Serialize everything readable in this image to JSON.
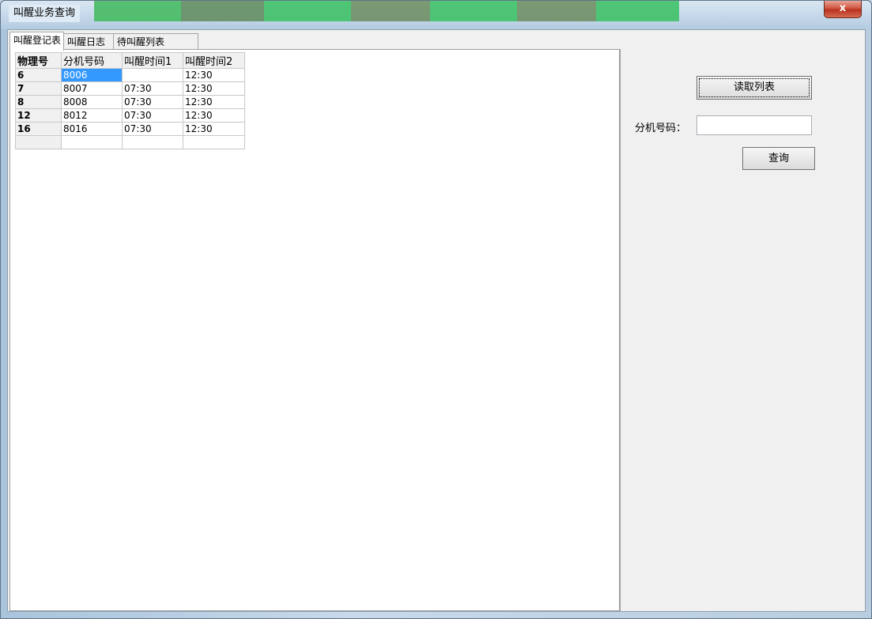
{
  "window": {
    "title": "叫醒业务查询",
    "close_label": "x"
  },
  "tabs": [
    {
      "label": "叫醒登记表"
    },
    {
      "label": "叫醒日志"
    },
    {
      "label": "待叫醒列表"
    }
  ],
  "grid": {
    "headers": [
      "物理号",
      "分机号码",
      "叫醒时间1",
      "叫醒时间2"
    ],
    "rows": [
      {
        "id": "6",
        "ext": "8006",
        "t1": "",
        "t2": "12:30"
      },
      {
        "id": "7",
        "ext": "8007",
        "t1": "07:30",
        "t2": "12:30"
      },
      {
        "id": "8",
        "ext": "8008",
        "t1": "07:30",
        "t2": "12:30"
      },
      {
        "id": "12",
        "ext": "8012",
        "t1": "07:30",
        "t2": "12:30"
      },
      {
        "id": "16",
        "ext": "8016",
        "t1": "07:30",
        "t2": "12:30"
      }
    ],
    "selected_cell": "8006"
  },
  "panel": {
    "read_list_label": "读取列表",
    "ext_label": "分机号码：",
    "ext_value": "",
    "query_label": "查询"
  },
  "colors": {
    "selection": "#3399ff",
    "close_button": "#c9462f"
  }
}
